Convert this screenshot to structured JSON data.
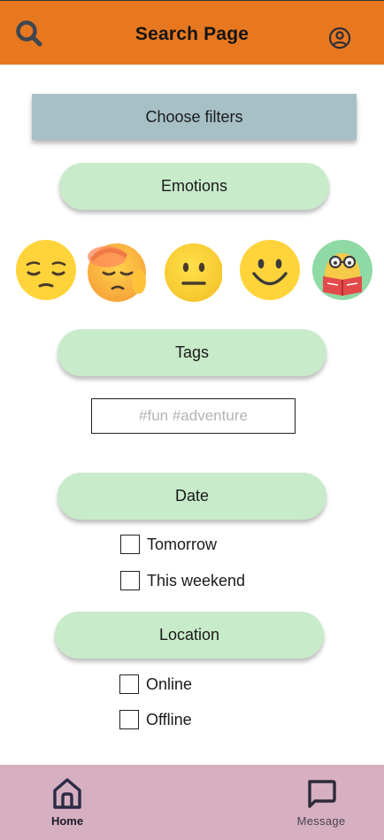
{
  "header": {
    "title": "Search Page",
    "search_icon": "search-icon",
    "account_icon": "account-circle-icon",
    "background": "#e8781f"
  },
  "filters": {
    "heading": "Choose filters",
    "background": "#a6c0c6"
  },
  "emotions": {
    "label": "Emotions",
    "items": [
      {
        "name": "pensive-face",
        "icon": "pensive-face-icon"
      },
      {
        "name": "face-palm",
        "icon": "face-palm-icon"
      },
      {
        "name": "neutral-face",
        "icon": "neutral-face-icon"
      },
      {
        "name": "smiling-face",
        "icon": "smiling-face-icon"
      },
      {
        "name": "nerd-reading",
        "icon": "nerd-reading-icon"
      }
    ]
  },
  "tags": {
    "label": "Tags",
    "placeholder": "#fun #adventure",
    "value": ""
  },
  "date": {
    "label": "Date",
    "options": [
      {
        "label": "Tomorrow",
        "checked": false
      },
      {
        "label": "This weekend",
        "checked": false
      }
    ]
  },
  "location": {
    "label": "Location",
    "options": [
      {
        "label": "Online",
        "checked": false
      },
      {
        "label": "Offline",
        "checked": false
      }
    ]
  },
  "bottom_nav": {
    "items": [
      {
        "label": "Home",
        "icon": "home-icon",
        "active": true
      },
      {
        "label": "Message",
        "icon": "message-icon",
        "active": false
      }
    ],
    "background": "#d6afc0"
  },
  "colors": {
    "pill": "#c8ebc9",
    "emoji_yellow": "#ffd43b"
  }
}
